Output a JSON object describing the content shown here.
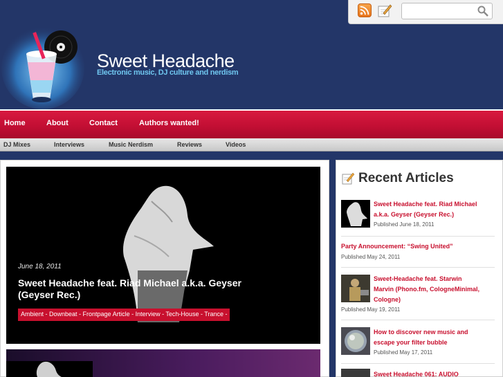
{
  "site": {
    "title": "Sweet Headache",
    "tagline": "Electronic music, DJ culture and nerdism"
  },
  "header_tools": {
    "rss_icon": "rss-icon",
    "edit_icon": "pencil-note-icon",
    "search_icon": "magnifier-icon",
    "search_value": ""
  },
  "main_nav": [
    {
      "label": "Home"
    },
    {
      "label": "About"
    },
    {
      "label": "Contact"
    },
    {
      "label": "Authors wanted!"
    }
  ],
  "sub_nav": [
    {
      "label": "DJ Mixes"
    },
    {
      "label": "Interviews"
    },
    {
      "label": "Music Nerdism"
    },
    {
      "label": "Reviews"
    },
    {
      "label": "Videos"
    }
  ],
  "featured": {
    "date": "June 18, 2011",
    "title": "Sweet Headache feat. Riad Michael a.k.a. Geyser (Geyser Rec.)",
    "tags": "Ambient - Downbeat - Frontpage Article - Interview - Tech-House - Trance -"
  },
  "sidebar": {
    "heading": "Recent Articles",
    "articles": [
      {
        "title_line1": "Sweet Headache feat. Riad Michael",
        "title_line2": "a.k.a. Geyser (Geyser Rec.)",
        "meta": "Published June 18, 2011"
      },
      {
        "title_line1": "Party Announcement: “Swing United”",
        "meta": "Published May 24, 2011"
      },
      {
        "title_line1": "Sweet-Headache feat. Starwin",
        "title_line2": "Marvin (Phono.fm, CologneMinimal,",
        "title_line3": "Cologne)",
        "meta": "Published May 19, 2011"
      },
      {
        "title_line1": "How to discover new music and",
        "title_line2": "escape your filter bubble",
        "meta": "Published May 17, 2011"
      },
      {
        "title_line1": "Sweet Headache 061: AUDIO"
      }
    ]
  },
  "colors": {
    "header_bg": "#233668",
    "nav_red": "#c8102e",
    "tagline_blue": "#6fc6ef",
    "link_red": "#c8102e"
  }
}
